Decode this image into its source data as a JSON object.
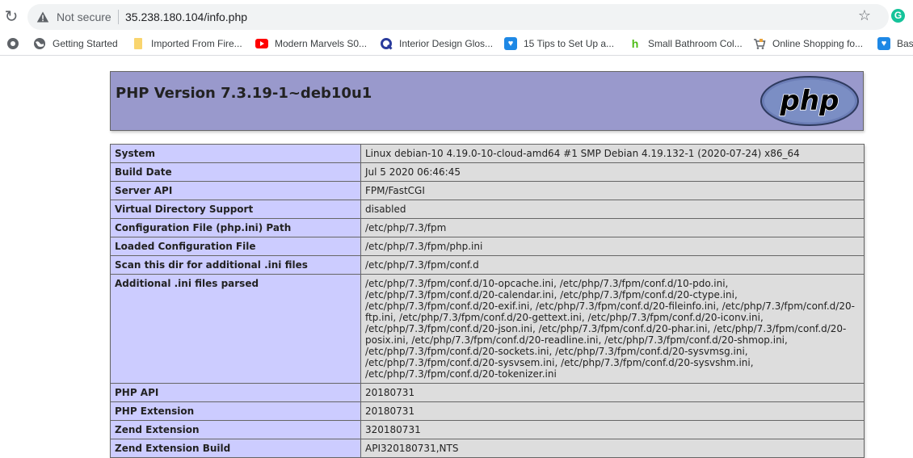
{
  "browser": {
    "security_label": "Not secure",
    "url": "35.238.180.104/info.php",
    "bookmarks": [
      {
        "label": "Getting Started",
        "icon": "globe-icon"
      },
      {
        "label": "Imported From Fire...",
        "icon": "folder-icon"
      },
      {
        "label": "Modern Marvels S0...",
        "icon": "youtube-icon"
      },
      {
        "label": "Interior Design Glos...",
        "icon": "q-icon"
      },
      {
        "label": "15 Tips to Set Up a...",
        "icon": "heart-icon"
      },
      {
        "label": "Small Bathroom Col...",
        "icon": "houzz-icon"
      },
      {
        "label": "Online Shopping fo...",
        "icon": "cart-icon"
      },
      {
        "label": "Basi",
        "icon": "heart-icon"
      }
    ]
  },
  "php": {
    "version_title": "PHP Version 7.3.19-1~deb10u1",
    "logo_text": "php",
    "rows": [
      {
        "label": "System",
        "value": "Linux debian-10 4.19.0-10-cloud-amd64 #1 SMP Debian 4.19.132-1 (2020-07-24) x86_64"
      },
      {
        "label": "Build Date",
        "value": "Jul 5 2020 06:46:45"
      },
      {
        "label": "Server API",
        "value": "FPM/FastCGI"
      },
      {
        "label": "Virtual Directory Support",
        "value": "disabled"
      },
      {
        "label": "Configuration File (php.ini) Path",
        "value": "/etc/php/7.3/fpm"
      },
      {
        "label": "Loaded Configuration File",
        "value": "/etc/php/7.3/fpm/php.ini"
      },
      {
        "label": "Scan this dir for additional .ini files",
        "value": "/etc/php/7.3/fpm/conf.d"
      },
      {
        "label": "Additional .ini files parsed",
        "value": "/etc/php/7.3/fpm/conf.d/10-opcache.ini, /etc/php/7.3/fpm/conf.d/10-pdo.ini, /etc/php/7.3/fpm/conf.d/20-calendar.ini, /etc/php/7.3/fpm/conf.d/20-ctype.ini, /etc/php/7.3/fpm/conf.d/20-exif.ini, /etc/php/7.3/fpm/conf.d/20-fileinfo.ini, /etc/php/7.3/fpm/conf.d/20-ftp.ini, /etc/php/7.3/fpm/conf.d/20-gettext.ini, /etc/php/7.3/fpm/conf.d/20-iconv.ini, /etc/php/7.3/fpm/conf.d/20-json.ini, /etc/php/7.3/fpm/conf.d/20-phar.ini, /etc/php/7.3/fpm/conf.d/20-posix.ini, /etc/php/7.3/fpm/conf.d/20-readline.ini, /etc/php/7.3/fpm/conf.d/20-shmop.ini, /etc/php/7.3/fpm/conf.d/20-sockets.ini, /etc/php/7.3/fpm/conf.d/20-sysvmsg.ini, /etc/php/7.3/fpm/conf.d/20-sysvsem.ini, /etc/php/7.3/fpm/conf.d/20-sysvshm.ini, /etc/php/7.3/fpm/conf.d/20-tokenizer.ini"
      },
      {
        "label": "PHP API",
        "value": "20180731"
      },
      {
        "label": "PHP Extension",
        "value": "20180731"
      },
      {
        "label": "Zend Extension",
        "value": "320180731"
      },
      {
        "label": "Zend Extension Build",
        "value": "API320180731,NTS"
      }
    ]
  },
  "colors": {
    "header_bg": "#9999cc",
    "label_bg": "#ccccff",
    "value_bg": "#dddddd"
  }
}
